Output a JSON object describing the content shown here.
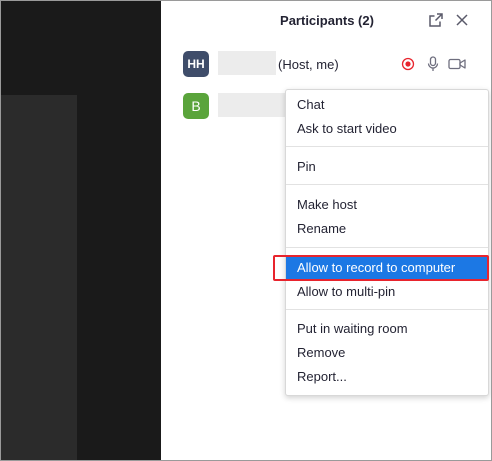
{
  "panel": {
    "title": "Participants (2)",
    "popout_icon": "popout-icon",
    "close_icon": "close-icon"
  },
  "participants": [
    {
      "avatar_initials": "HH",
      "role": "(Host, me)",
      "avatar_color": "#3f4d6a",
      "icons": [
        "record-icon",
        "microphone-icon",
        "video-camera-icon"
      ]
    },
    {
      "avatar_initials": "B",
      "avatar_color": "#5aa43b"
    }
  ],
  "context_menu": {
    "items": [
      {
        "label": "Chat"
      },
      {
        "label": "Ask to start video"
      },
      {
        "label": "Pin"
      },
      {
        "label": "Make host"
      },
      {
        "label": "Rename"
      },
      {
        "label": "Allow to record to computer",
        "selected": true
      },
      {
        "label": "Allow to multi-pin"
      },
      {
        "label": "Put in waiting room"
      },
      {
        "label": "Remove"
      },
      {
        "label": "Report..."
      }
    ]
  },
  "colors": {
    "selected_item": "#1c78e4",
    "highlight_border": "#e8242d",
    "record_icon": "#e8242d"
  }
}
